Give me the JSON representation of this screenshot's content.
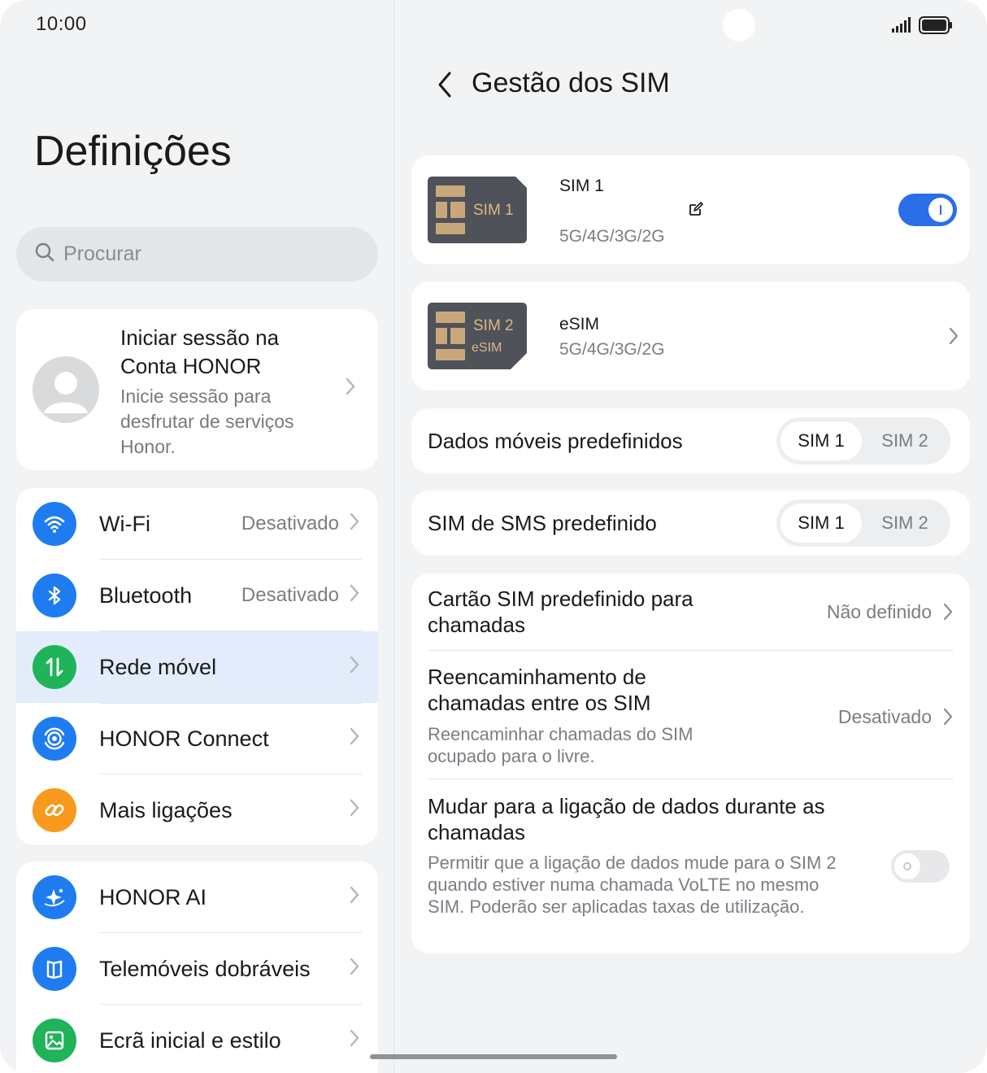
{
  "status": {
    "time": "10:00"
  },
  "left": {
    "title": "Definições",
    "search": {
      "placeholder": "Procurar"
    },
    "account": {
      "title": "Iniciar sessão na Conta HONOR",
      "subtitle": "Inicie sessão para desfrutar de serviços Honor."
    },
    "group1": [
      {
        "label": "Wi-Fi",
        "value": "Desativado",
        "icon": "wifi-icon",
        "color": "#1f7cf0"
      },
      {
        "label": "Bluetooth",
        "value": "Desativado",
        "icon": "bluetooth-icon",
        "color": "#1f7cf0"
      },
      {
        "label": "Rede móvel",
        "value": "",
        "icon": "mobile-network-icon",
        "color": "#1fb35a",
        "selected": true
      },
      {
        "label": "HONOR Connect",
        "value": "",
        "icon": "honor-connect-icon",
        "color": "#1f7cf0"
      },
      {
        "label": "Mais ligações",
        "value": "",
        "icon": "link-icon",
        "color": "#f79a1e"
      }
    ],
    "group2": [
      {
        "label": "HONOR AI",
        "icon": "honor-ai-icon",
        "color": "#1f7cf0"
      },
      {
        "label": "Telemóveis dobráveis",
        "icon": "foldable-icon",
        "color": "#1f7cf0"
      },
      {
        "label": "Ecrã inicial e estilo",
        "icon": "wallpaper-icon",
        "color": "#1fb35a"
      }
    ]
  },
  "right": {
    "title": "Gestão dos SIM",
    "sim1": {
      "card_label": "SIM 1",
      "name": "SIM 1",
      "network": "5G/4G/3G/2G",
      "enabled": true
    },
    "sim2": {
      "card_label": "SIM 2",
      "card_sub": "eSIM",
      "name": "eSIM",
      "network": "5G/4G/3G/2G"
    },
    "default_data": {
      "label": "Dados móveis predefinidos",
      "options": [
        "SIM 1",
        "SIM 2"
      ],
      "selected": "SIM 1"
    },
    "default_sms": {
      "label": "SIM de SMS predefinido",
      "options": [
        "SIM 1",
        "SIM 2"
      ],
      "selected": "SIM 1"
    },
    "default_calls": {
      "label": "Cartão SIM predefinido para chamadas",
      "value": "Não definido"
    },
    "call_forwarding": {
      "label": "Reencaminhamento de chamadas entre os SIM",
      "description": "Reencaminhar chamadas do SIM ocupado para o livre.",
      "value": "Desativado"
    },
    "data_switch": {
      "label": "Mudar para a ligação de dados durante as chamadas",
      "description": "Permitir que a ligação de dados mude para o SIM 2 quando estiver numa chamada VoLTE no mesmo SIM. Poderão ser aplicadas taxas de utilização.",
      "enabled": false
    }
  },
  "colors": {
    "accent": "#2a6ee8",
    "selected_row": "#e2ecfb",
    "green": "#1fb35a",
    "orange": "#f79a1e"
  }
}
